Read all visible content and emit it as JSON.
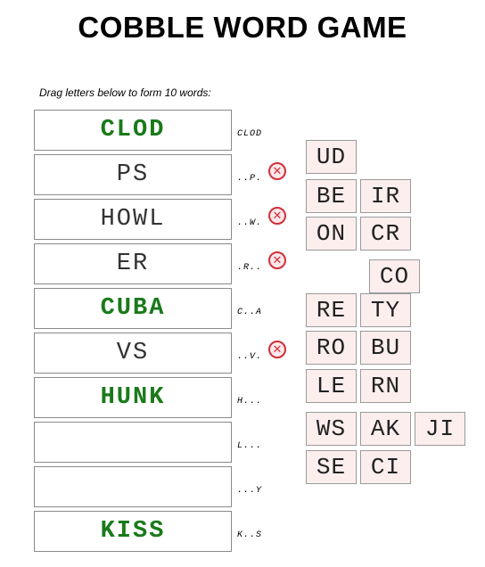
{
  "title": "COBBLE WORD GAME",
  "instructions": "Drag letters below to form 10 words:",
  "words": [
    {
      "text": "CLOD",
      "hint": "CLOD",
      "solved": true,
      "error": false
    },
    {
      "text": "PS",
      "hint": "..P.",
      "solved": false,
      "error": true
    },
    {
      "text": "HOWL",
      "hint": "..W.",
      "solved": false,
      "error": true
    },
    {
      "text": "ER",
      "hint": ".R..",
      "solved": false,
      "error": true
    },
    {
      "text": "CUBA",
      "hint": "C..A",
      "solved": true,
      "error": false
    },
    {
      "text": "VS",
      "hint": "..V.",
      "solved": false,
      "error": true
    },
    {
      "text": "HUNK",
      "hint": "H...",
      "solved": true,
      "error": false
    },
    {
      "text": "",
      "hint": "L...",
      "solved": false,
      "error": false
    },
    {
      "text": "",
      "hint": "...Y",
      "solved": false,
      "error": false
    },
    {
      "text": "KISS",
      "hint": "K..S",
      "solved": true,
      "error": false
    }
  ],
  "error_icon": "x-circle-icon",
  "tiles": [
    "UD",
    "BE",
    "IR",
    "ON",
    "CR",
    "CO",
    "RE",
    "TY",
    "RO",
    "BU",
    "LE",
    "RN",
    "WS",
    "AK",
    "JI",
    "SE",
    "CI"
  ],
  "colors": {
    "solved_text": "#1a7a1a",
    "tile_bg": "#fdeeee",
    "error_red": "#d0303a"
  }
}
